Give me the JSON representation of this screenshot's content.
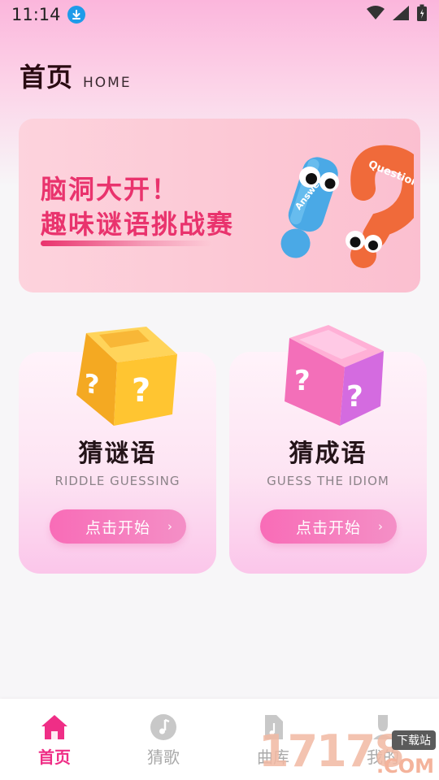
{
  "status_bar": {
    "time": "11:14",
    "icons": [
      "download-icon",
      "wifi-icon",
      "signal-icon",
      "battery-icon"
    ]
  },
  "header": {
    "title": "首页",
    "subtitle": "HOME"
  },
  "banner": {
    "line1": "脑洞大开！",
    "line2": "趣味谜语挑战赛",
    "art_words": [
      "Answer",
      "Question"
    ]
  },
  "cards": [
    {
      "title": "猜谜语",
      "subtitle": "RIDDLE GUESSING",
      "button_label": "点击开始",
      "icon": "yellow-question-cube-icon"
    },
    {
      "title": "猜成语",
      "subtitle": "GUESS THE IDIOM",
      "button_label": "点击开始",
      "icon": "pink-question-cube-icon"
    }
  ],
  "bottom_nav": {
    "items": [
      {
        "label": "首页",
        "icon": "home-icon",
        "active": true
      },
      {
        "label": "猜歌",
        "icon": "music-note-icon",
        "active": false
      },
      {
        "label": "曲库",
        "icon": "music-file-icon",
        "active": false
      },
      {
        "label": "我的",
        "icon": "profile-icon",
        "active": false
      }
    ]
  },
  "watermark": {
    "digits": "17178",
    "tag": "下载站",
    "domain": ".COM"
  },
  "colors": {
    "accent_pink": "#ef2e86",
    "banner_text": "#e9336d",
    "button_pink": "#f86cb7"
  }
}
